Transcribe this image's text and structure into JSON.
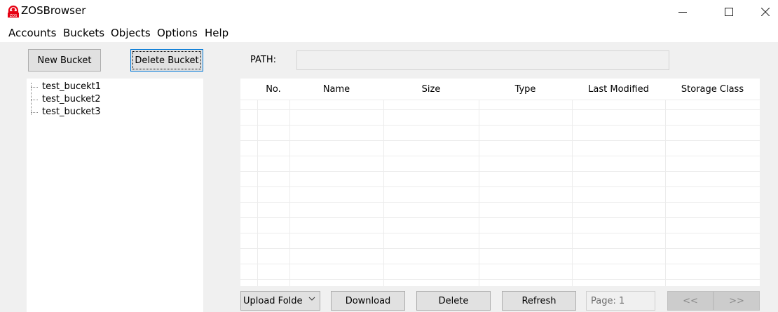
{
  "window": {
    "title": "ZOSBrowser",
    "icon": "zos-logo-icon",
    "controls": [
      "minimize-icon",
      "maximize-icon",
      "close-icon"
    ]
  },
  "menu": {
    "items": [
      "Accounts",
      "Buckets",
      "Objects",
      "Options",
      "Help"
    ]
  },
  "toolbar": {
    "new_bucket": "New Bucket",
    "delete_bucket": "Delete Bucket",
    "path_label": "PATH:",
    "path_value": ""
  },
  "buckets": [
    "test_bucekt1",
    "test_bucket2",
    "test_bucket3"
  ],
  "table": {
    "columns": [
      "No.",
      "Name",
      "Size",
      "Type",
      "Last Modified",
      "Storage Class"
    ],
    "rows": []
  },
  "footer": {
    "upload_selected": "Upload Folde",
    "download": "Download",
    "delete": "Delete",
    "refresh": "Refresh",
    "page_placeholder": "Page: 1",
    "prev": "<<",
    "next": ">>"
  },
  "colors": {
    "accent": "#0078d7",
    "logo_red": "#e60012",
    "window_bg": "#f0f0f0"
  }
}
